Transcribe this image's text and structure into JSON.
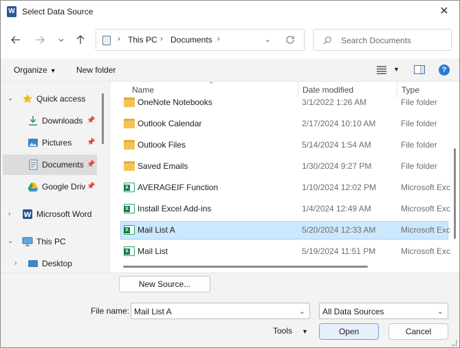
{
  "window": {
    "title": "Select Data Source",
    "app_icon_letter": "W",
    "close_glyph": "✕"
  },
  "address_bar": {
    "breadcrumbs": [
      "This PC",
      "Documents"
    ],
    "separator": "›"
  },
  "search": {
    "placeholder": "Search Documents"
  },
  "toolbar": {
    "organize_label": "Organize",
    "new_folder_label": "New folder",
    "help_glyph": "?"
  },
  "nav_pane": {
    "items": [
      {
        "label": "Quick access",
        "icon": "star-icon",
        "expand": "⌄",
        "pinned": false
      },
      {
        "label": "Downloads",
        "icon": "download-icon",
        "pinned": true
      },
      {
        "label": "Pictures",
        "icon": "pictures-icon",
        "pinned": true
      },
      {
        "label": "Documents",
        "icon": "documents-icon",
        "pinned": true,
        "selected": true
      },
      {
        "label": "Google Drive",
        "icon": "google-drive-icon",
        "pinned": true
      },
      {
        "label": "Microsoft Word",
        "icon": "word-icon",
        "expand": "›"
      },
      {
        "label": "This PC",
        "icon": "pc-icon",
        "expand": "⌄"
      },
      {
        "label": "Desktop",
        "icon": "desktop-icon",
        "expand": "›"
      }
    ]
  },
  "file_list": {
    "columns": {
      "name": "Name",
      "date": "Date modified",
      "type": "Type"
    },
    "rows": [
      {
        "name": "OneNote Notebooks",
        "date": "3/1/2022 1:26 AM",
        "type": "File folder",
        "kind": "folder"
      },
      {
        "name": "Outlook Calendar",
        "date": "2/17/2024 10:10 AM",
        "type": "File folder",
        "kind": "folder"
      },
      {
        "name": "Outlook Files",
        "date": "5/14/2024 1:54 AM",
        "type": "File folder",
        "kind": "folder"
      },
      {
        "name": "Saved Emails",
        "date": "1/30/2024 9:27 PM",
        "type": "File folder",
        "kind": "folder"
      },
      {
        "name": "AVERAGEIF Function",
        "date": "1/10/2024 12:02 PM",
        "type": "Microsoft Excel",
        "kind": "excel"
      },
      {
        "name": "Install Excel Add-ins",
        "date": "1/4/2024 12:49 AM",
        "type": "Microsoft Excel",
        "kind": "excel"
      },
      {
        "name": "Mail List A",
        "date": "5/20/2024 12:33 AM",
        "type": "Microsoft Excel",
        "kind": "excel",
        "selected": true
      },
      {
        "name": "Mail List",
        "date": "5/19/2024 11:51 PM",
        "type": "Microsoft Excel",
        "kind": "excel"
      }
    ]
  },
  "footer": {
    "new_source_label": "New Source...",
    "file_name_label": "File name:",
    "file_name_value": "Mail List A",
    "filter_value": "All Data Sources",
    "tools_label": "Tools",
    "open_label": "Open",
    "cancel_label": "Cancel"
  },
  "colors": {
    "selection_bg": "#cce8ff",
    "selection_border": "#99d1ff",
    "folder": "#f3c453",
    "excel": "#107c41",
    "word": "#2b579a",
    "help": "#2a7bd4"
  }
}
